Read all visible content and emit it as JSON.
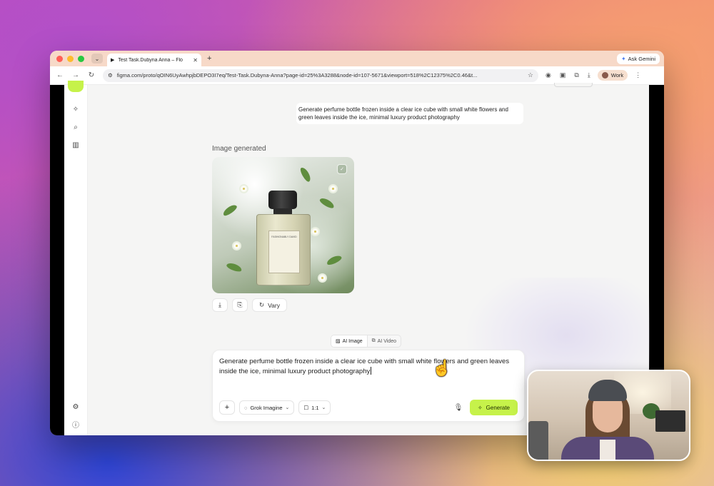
{
  "browser": {
    "tab_title": "Test Task.Dubyna Anna – Flo",
    "new_tab": "+",
    "ask_gemini": "Ask Gemini",
    "url": "figma.com/proto/qOIN6UyAwhpjbDEPO3I7eq/Test-Task.Dubyna-Anna?page-id=25%3A3288&node-id=107-5671&viewport=518%2C12375%2C0.46&t...",
    "profile_label": "Work"
  },
  "chat": {
    "user_message": "Generate perfume bottle frozen inside a clear ice cube with small white flowers and green leaves inside the ice, minimal luxury product photography",
    "generated_label": "Image generated",
    "vary_label": "Vary",
    "bottle_label_text": "FASHIONABLY DAVID"
  },
  "composer": {
    "mode_image": "AI Image",
    "mode_video": "AI Video",
    "prompt": "Generate perfume bottle frozen inside a clear ice cube with small white flowers and green leaves inside the ice, minimal luxury product photography",
    "model_label": "Grok Imagine",
    "ratio_label": "1:1",
    "generate_label": "Generate"
  },
  "colors": {
    "accent": "#c6f24a",
    "tab_bar": "#f7d9c8",
    "app_bg": "#f5f5f4"
  },
  "icons": [
    "sparkle-wand-icon",
    "search-icon",
    "library-icon",
    "settings-icon",
    "info-icon",
    "download-icon",
    "bookmark-icon",
    "refresh-icon",
    "mic-icon",
    "shield-check-icon"
  ]
}
